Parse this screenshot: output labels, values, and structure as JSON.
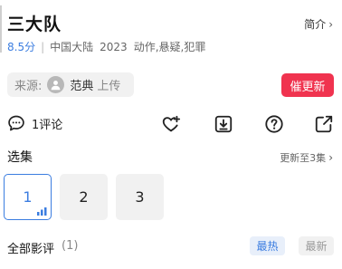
{
  "header": {
    "title": "三大队",
    "intro_label": "简介"
  },
  "meta": {
    "score": "8.5分",
    "region": "中国大陆",
    "year": "2023",
    "genres": "动作,悬疑,犯罪"
  },
  "source": {
    "label": "来源:",
    "uploader": "范典",
    "upload_text": "上传"
  },
  "urge_update_label": "催更新",
  "actions": {
    "comment_label": "1评论"
  },
  "episodes": {
    "heading": "选集",
    "update_note": "更新至3集",
    "items": [
      {
        "label": "1"
      },
      {
        "label": "2"
      },
      {
        "label": "3"
      }
    ]
  },
  "reviews": {
    "heading": "全部影评",
    "count": "(1)",
    "sort_hot": "最热",
    "sort_new": "最新"
  },
  "colors": {
    "accent": "#3b7de0",
    "urge": "#f0334f"
  }
}
